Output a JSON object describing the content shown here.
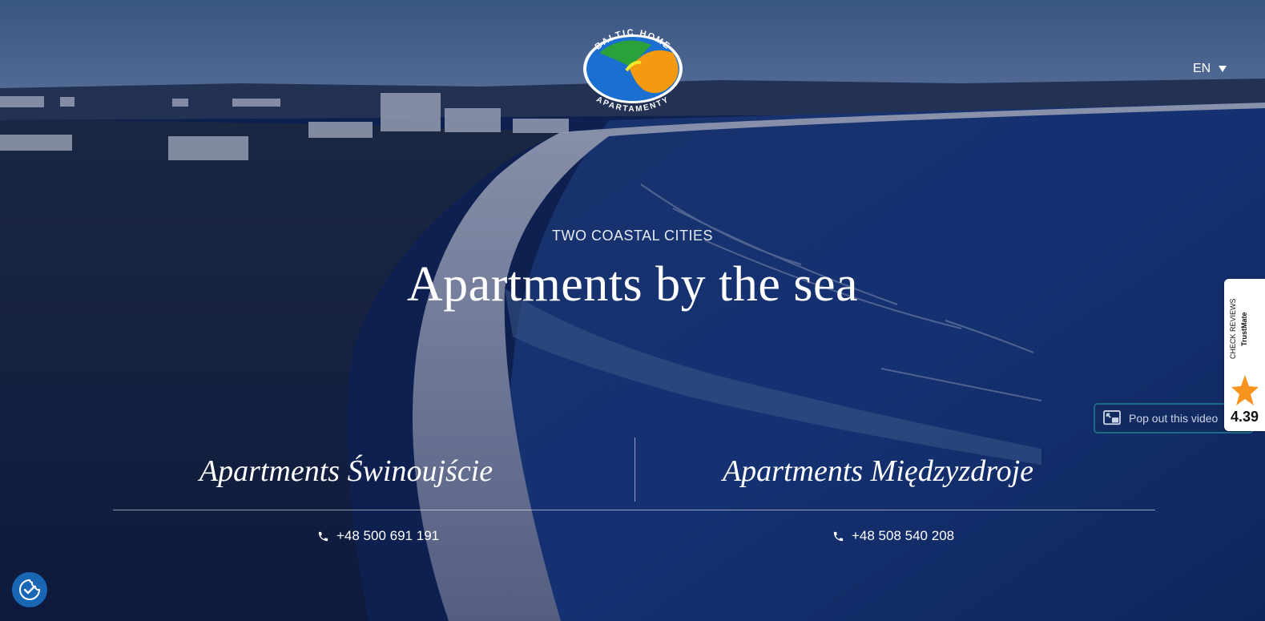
{
  "header": {
    "logo": {
      "top_text": "BALTIC HOME",
      "bottom_text": "APARTAMENTY"
    },
    "language": {
      "selected": "EN"
    }
  },
  "hero": {
    "kicker": "TWO COASTAL CITIES",
    "headline": "Apartments by the sea"
  },
  "locations": [
    {
      "name": "Apartments Świnoujście",
      "phone": "+48 500 691 191"
    },
    {
      "name": "Apartments Międzyzdroje",
      "phone": "+48 508 540 208"
    }
  ],
  "video": {
    "popout_label": "Pop out this video"
  },
  "trustmate": {
    "label": "CHECK REVIEWS",
    "brand": "TrustMate",
    "rating": "4.39"
  },
  "icons": {
    "phone": "phone-icon",
    "cookie": "cookie-consent-icon",
    "popout": "picture-in-picture-icon",
    "caret": "chevron-down-icon"
  },
  "colors": {
    "overlay": "#0e1e4e",
    "cookie_button": "#1866b4",
    "popout_border": "#1d6b86",
    "trust_star": "#f7931e"
  }
}
